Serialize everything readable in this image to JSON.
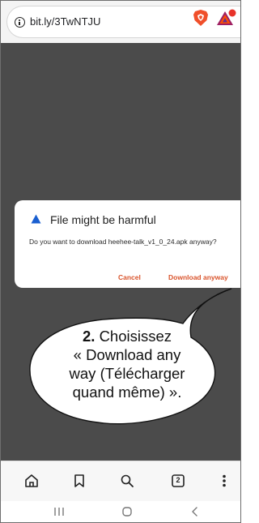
{
  "browser": {
    "url": "bit.ly/3TwNTJU",
    "icons": [
      "info-icon",
      "brave-shields-icon",
      "brave-rewards-icon"
    ]
  },
  "dialog": {
    "title": "File might be harmful",
    "message": "Do you want to download heehee-talk_v1_0_24.apk anyway?",
    "cancel_label": "Cancel",
    "download_label": "Download anyway",
    "accent_color": "#d9532b"
  },
  "callout": {
    "step": "2.",
    "line1": "Choisissez",
    "line2": "« Download any",
    "line3": "way (Télécharger",
    "line4": "quand même) »."
  },
  "bottom_nav": {
    "tab_count": "2",
    "icons": [
      "home-icon",
      "bookmark-icon",
      "search-icon",
      "tabs-icon",
      "menu-icon"
    ]
  },
  "system_nav": {
    "icons": [
      "recents-icon",
      "home-icon",
      "back-icon"
    ]
  }
}
